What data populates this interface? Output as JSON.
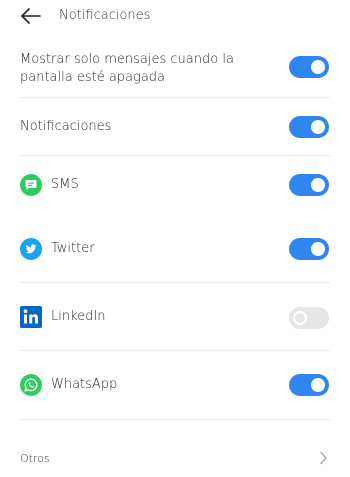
{
  "header": {
    "title": "Notificaciones"
  },
  "settings": {
    "screen_off": {
      "label": "Mostrar solo mensajes cuando la pantalla esté apagada",
      "enabled": true
    },
    "notifications": {
      "label": "Notificaciones",
      "enabled": true
    }
  },
  "apps": [
    {
      "label": "SMS",
      "icon": "sms-icon",
      "enabled": true
    },
    {
      "label": "Twitter",
      "icon": "twitter-icon",
      "enabled": true
    },
    {
      "label": "LinkedIn",
      "icon": "linkedin-icon",
      "enabled": false
    },
    {
      "label": "WhatsApp",
      "icon": "whatsapp-icon",
      "enabled": true
    }
  ],
  "others": {
    "label": "Otros"
  },
  "colors": {
    "accent": "#2f86f0",
    "toggle_off": "#e6e6e6",
    "sms": "#2ecc5d",
    "twitter": "#1da1f2",
    "linkedin": "#0a66c2",
    "whatsapp": "#2ecc5d"
  }
}
